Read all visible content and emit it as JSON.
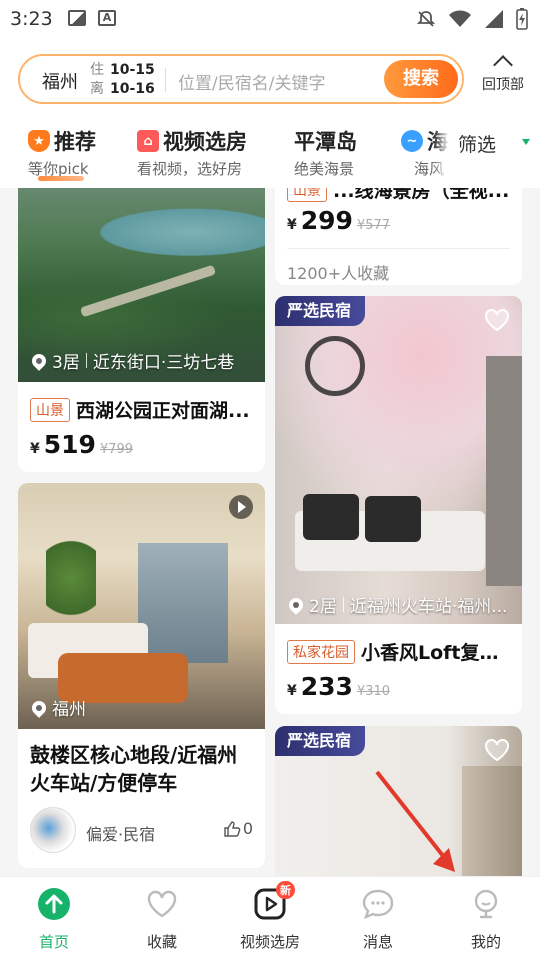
{
  "status_bar": {
    "time": "3:23",
    "icons": [
      "image-icon",
      "text-a-icon",
      "bell-off-icon",
      "wifi-icon",
      "signal-icon",
      "battery-charging-icon"
    ]
  },
  "search": {
    "city": "福州",
    "checkin_label": "住",
    "checkout_label": "离",
    "checkin_date": "10-15",
    "checkout_date": "10-16",
    "placeholder": "位置/民宿名/关键字",
    "button_label": "搜索",
    "back_to_top_label": "回顶部"
  },
  "categories": [
    {
      "title": "推荐",
      "subtitle": "等你pick",
      "icon": "star-badge-icon",
      "active": true
    },
    {
      "title": "视频选房",
      "subtitle": "看视频，选好房",
      "icon": "house-badge-icon",
      "active": false
    },
    {
      "title": "平潭岛",
      "subtitle": "绝美海景",
      "icon": "",
      "active": false
    },
    {
      "title": "海",
      "subtitle": "海风",
      "icon": "wave-badge-icon",
      "active": false
    }
  ],
  "filter": {
    "label": "筛选"
  },
  "listings": {
    "l1": {
      "location": "3居",
      "area": "近东街口·三坊七巷",
      "tag": "山景",
      "title": "西湖公园正对面湖...",
      "currency": "¥",
      "price": "519",
      "original_price": "¥799"
    },
    "l2": {
      "tag": "山景",
      "title": "...线海景房（全视...",
      "currency": "¥",
      "price": "299",
      "original_price": "¥577",
      "favorites": "1200+人收藏"
    },
    "l3": {
      "badge": "严选民宿",
      "location": "2居",
      "area": "近福州火车站·福州...",
      "tag": "私家花园",
      "title": "小香风Loft复式...",
      "currency": "¥",
      "price": "233",
      "original_price": "¥310"
    },
    "l4": {
      "location": "福州",
      "title": "鼓楼区核心地段/近福州火车站/方便停车",
      "host": "偏爱·民宿",
      "likes": "0"
    },
    "l5": {
      "badge": "严选民宿"
    }
  },
  "bottom_nav": [
    {
      "label": "首页",
      "icon": "arrow-up-circle-icon",
      "active": true
    },
    {
      "label": "收藏",
      "icon": "heart-icon",
      "active": false
    },
    {
      "label": "视频选房",
      "icon": "play-square-icon",
      "active": false,
      "badge": "新"
    },
    {
      "label": "消息",
      "icon": "chat-bubble-icon",
      "active": false
    },
    {
      "label": "我的",
      "icon": "user-icon",
      "active": false
    }
  ],
  "colors": {
    "accent_green": "#18b36a",
    "search_orange": "#ff6a1a",
    "badge_navy": "#2c2f6e",
    "tag_orange": "#d85c2a",
    "new_red": "#ff4b3a"
  }
}
